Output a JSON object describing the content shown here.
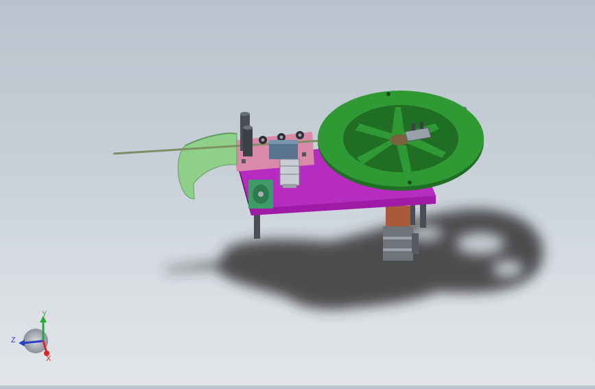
{
  "viewport": {
    "background_top": "#b9c3cd",
    "background_bottom": "#e2e5e8"
  },
  "model": {
    "colors": {
      "base_plate": "#a01aa8",
      "base_plate_top": "#b62cc0",
      "wheel": "#2f9a34",
      "wheel_dark": "#1f6e23",
      "guide_shield": "#8fd08a",
      "mount_plate": "#d98aa8",
      "motor": "#3f9c68",
      "cylinder": "#c9cdd4",
      "block": "#5a7390",
      "post": "#4a4f57",
      "gearbox": "#a85a3a",
      "wire": "#7f8f63",
      "shadow": "#2e2e2e"
    }
  },
  "triad": {
    "icon": "coordinate-triad-icon",
    "x_label": "X",
    "y_label": "Y",
    "z_label": "Z",
    "x_color": "#d9262b",
    "y_color": "#28a83a",
    "z_color": "#2740c4"
  }
}
